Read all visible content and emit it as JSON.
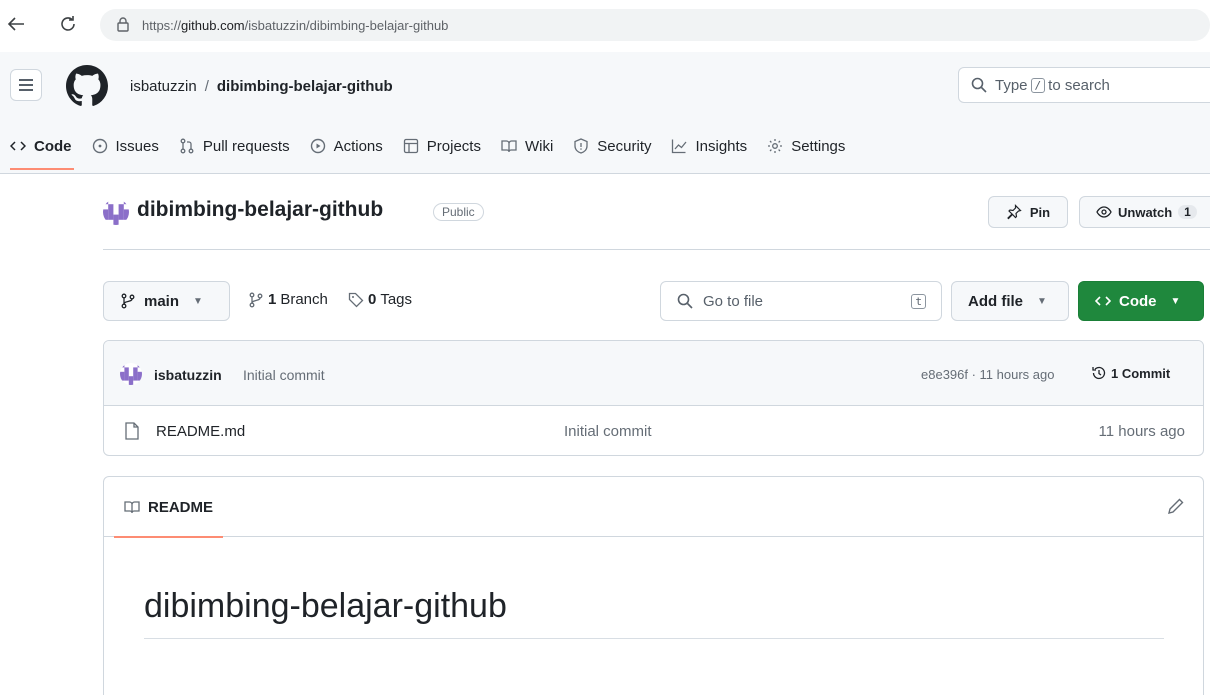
{
  "browser": {
    "url_prefix": "https://",
    "url_domain": "github.com",
    "url_path": "/isbatuzzin/dibimbing-belajar-github"
  },
  "header": {
    "owner": "isbatuzzin",
    "separator": "/",
    "repo": "dibimbing-belajar-github",
    "search_prefix": "Type",
    "search_key": "/",
    "search_suffix": "to search"
  },
  "tabs": [
    {
      "label": "Code",
      "icon": "code-icon"
    },
    {
      "label": "Issues",
      "icon": "issue-icon"
    },
    {
      "label": "Pull requests",
      "icon": "pull-request-icon"
    },
    {
      "label": "Actions",
      "icon": "play-icon"
    },
    {
      "label": "Projects",
      "icon": "table-icon"
    },
    {
      "label": "Wiki",
      "icon": "book-icon"
    },
    {
      "label": "Security",
      "icon": "shield-icon"
    },
    {
      "label": "Insights",
      "icon": "graph-icon"
    },
    {
      "label": "Settings",
      "icon": "gear-icon"
    }
  ],
  "repo_header": {
    "name": "dibimbing-belajar-github",
    "visibility": "Public",
    "pin_label": "Pin",
    "watch_label": "Unwatch",
    "watch_count": "1"
  },
  "toolbar": {
    "branch": "main",
    "branches_count": "1",
    "branches_label": "Branch",
    "tags_count": "0",
    "tags_label": "Tags",
    "goto_placeholder": "Go to file",
    "goto_key": "t",
    "add_file_label": "Add file",
    "code_label": "Code"
  },
  "latest_commit": {
    "author": "isbatuzzin",
    "message": "Initial commit",
    "meta": "e8e396f · 11 hours ago",
    "count_label": "1 Commit"
  },
  "files": [
    {
      "name": "README.md",
      "commit": "Initial commit",
      "time": "11 hours ago"
    }
  ],
  "readme": {
    "tab_label": "README",
    "heading": "dibimbing-belajar-github"
  },
  "colors": {
    "accent_tab": "#fd8c73",
    "code_button": "#1f883d",
    "border": "#d0d7de"
  }
}
